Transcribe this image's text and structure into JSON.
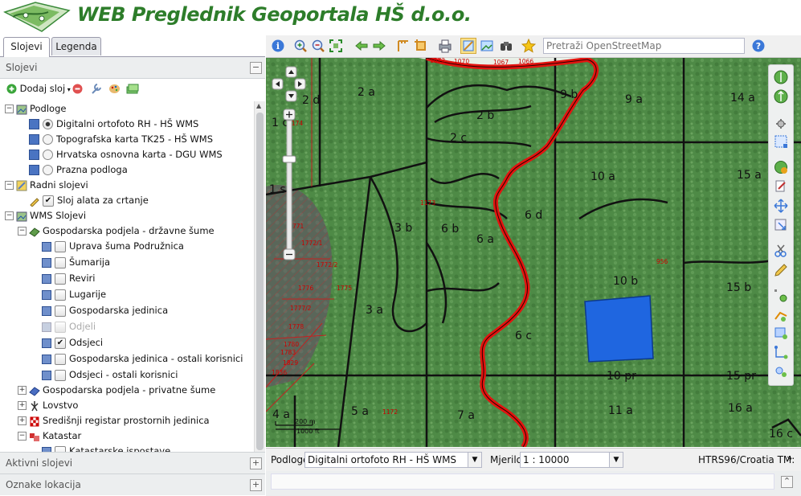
{
  "app": {
    "title": "WEB Preglednik Geoportala HŠ d.o.o."
  },
  "tabs": [
    {
      "label": "Slojevi",
      "active": true
    },
    {
      "label": "Legenda",
      "active": false
    }
  ],
  "layers_panel": {
    "title": "Slojevi",
    "add_layer_label": "Dodaj sloj",
    "tree": [
      {
        "label": "Podloge"
      },
      {
        "label": "Digitalni ortofoto RH - HŠ WMS",
        "selected": true
      },
      {
        "label": "Topografska karta TK25 - HŠ WMS"
      },
      {
        "label": "Hrvatska osnovna karta - DGU WMS"
      },
      {
        "label": "Prazna podloga"
      },
      {
        "label": "Radni slojevi"
      },
      {
        "label": "Sloj alata za crtanje",
        "checked": true
      },
      {
        "label": "WMS Slojevi"
      },
      {
        "label": "Gospodarska podjela - državne šume"
      },
      {
        "label": "Uprava šuma Podružnica",
        "checked": false
      },
      {
        "label": "Šumarija",
        "checked": false
      },
      {
        "label": "Reviri",
        "checked": false
      },
      {
        "label": "Lugarije",
        "checked": false
      },
      {
        "label": "Gospodarska jedinica",
        "checked": false
      },
      {
        "label": "Odjeli",
        "checked": false,
        "disabled": true
      },
      {
        "label": "Odsjeci",
        "checked": true
      },
      {
        "label": "Gospodarska jedinica - ostali korisnici",
        "checked": false
      },
      {
        "label": "Odsjeci - ostali korisnici",
        "checked": false
      },
      {
        "label": "Gospodarska podjela - privatne šume"
      },
      {
        "label": "Lovstvo"
      },
      {
        "label": "Središnji registar prostornih jedinica"
      },
      {
        "label": "Katastar"
      },
      {
        "label": "Katastarske ispostave",
        "checked": false
      }
    ]
  },
  "sections": {
    "active_layers": "Aktivni slojevi",
    "location_markers": "Oznake lokacija"
  },
  "toolbar": {
    "search_placeholder": "Pretraži OpenStreetMap",
    "icons": [
      "info-icon",
      "zoom-in-icon",
      "zoom-out-icon",
      "zoom-extent-icon",
      "back-arrow-icon",
      "forward-arrow-icon",
      "measure-length-icon",
      "measure-area-icon",
      "print-icon",
      "layer-toggle-icon",
      "image-icon",
      "binoculars-icon",
      "star-icon",
      "help-icon"
    ]
  },
  "map": {
    "stand_labels": [
      "2 a",
      "2 d",
      "1 c",
      "2 b",
      "2 c",
      "9 b",
      "9 a",
      "14 a",
      "1 s",
      "10 a",
      "15 a",
      "3 b",
      "6 b",
      "6 a",
      "6 d",
      "3 a",
      "10 b",
      "15 b",
      "6 c",
      "10 pr",
      "15 pr",
      "4 a",
      "5 a",
      "7 a",
      "11 a",
      "16 a",
      "16 c"
    ],
    "parcel_labels": [
      "1072",
      "1070",
      "1067",
      "1066",
      "1174",
      "1173",
      "956",
      "1172",
      "771",
      "1772/1",
      "1772/2",
      "1776",
      "1775",
      "1777/2",
      "1778",
      "1780",
      "1783",
      "1829",
      "1836"
    ],
    "scale_bar": {
      "metric": "200 m",
      "imperial": "1000 ft"
    },
    "colors": {
      "forest": "#4e8a46",
      "boundary": "#e3130f",
      "selection": "#1f66e0"
    }
  },
  "statusbar": {
    "basemap_label": "Podloge",
    "basemap_value": "Digitalni ortofoto RH - HŠ WMS",
    "scale_label": "Mjerilo",
    "scale_value": "1 : 10000",
    "crs": "HTRS96/Croatia TM:"
  }
}
